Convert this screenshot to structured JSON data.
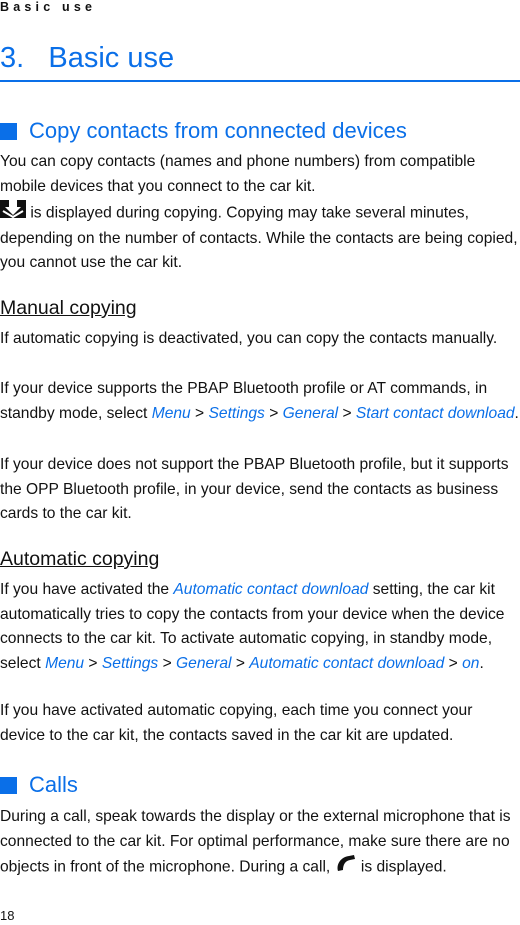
{
  "running_head": "Basic use",
  "chapter": {
    "title": "3.   Basic use"
  },
  "sections": {
    "copy": {
      "title": "Copy contacts from connected devices",
      "p1": "You can copy contacts (names and phone numbers) from compatible mobile devices that you connect to the car kit.",
      "p2_icon": "download-contacts-icon",
      "p2": " is displayed during copying. Copying may take several minutes, depending on the number of contacts. While the contacts are being copied, you cannot use the car kit."
    },
    "manual": {
      "title": "Manual copying",
      "p1": "If automatic copying is deactivated, you can copy the contacts manually.",
      "p2_pre": "If your device supports the PBAP Bluetooth profile or AT commands, in standby mode, select ",
      "p2_links": [
        "Menu",
        "Settings",
        "General",
        "Start contact download"
      ],
      "sep": " > ",
      "p2_post": ".",
      "p3": "If your device does not support the PBAP Bluetooth profile, but it supports the OPP Bluetooth profile, in your device, send the contacts as business cards to the car kit."
    },
    "automatic": {
      "title": "Automatic copying",
      "p1_pre": "If you have activated the ",
      "p1_link": "Automatic contact download",
      "p1_post": " setting, the car kit automatically tries to copy the contacts from your device when the device connects to the car kit. To activate automatic copying, in standby mode, select ",
      "p1_links": [
        "Menu",
        "Settings",
        "General",
        "Automatic contact download",
        "on"
      ],
      "p1_end": ".",
      "p2": "If you have activated automatic copying, each time you connect your device to the car kit, the contacts saved in the car kit are updated."
    },
    "calls": {
      "title": "Calls",
      "p1_pre": "During a call, speak towards the display or the external microphone that is connected to the car kit. For optimal performance, make sure there are no objects in front of the microphone. During a call, ",
      "p1_icon": "phone-handset-icon",
      "p1_post": " is displayed."
    }
  },
  "page_number": "18",
  "colors": {
    "accent": "#0a6fe8",
    "text": "#111111"
  }
}
